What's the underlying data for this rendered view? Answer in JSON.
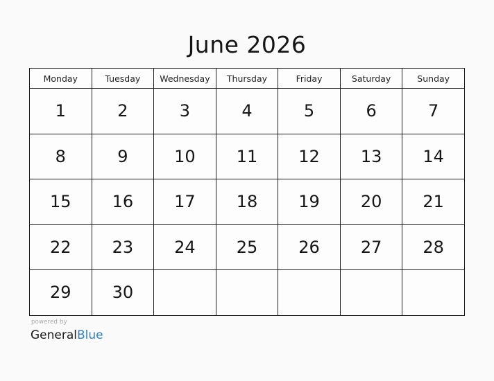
{
  "calendar": {
    "title": "June 2026",
    "month": "June",
    "year": "2026",
    "weekday_headers": [
      "Monday",
      "Tuesday",
      "Wednesday",
      "Thursday",
      "Friday",
      "Saturday",
      "Sunday"
    ],
    "weeks": [
      [
        "1",
        "2",
        "3",
        "4",
        "5",
        "6",
        "7"
      ],
      [
        "8",
        "9",
        "10",
        "11",
        "12",
        "13",
        "14"
      ],
      [
        "15",
        "16",
        "17",
        "18",
        "19",
        "20",
        "21"
      ],
      [
        "22",
        "23",
        "24",
        "25",
        "26",
        "27",
        "28"
      ],
      [
        "29",
        "30",
        "",
        "",
        "",
        "",
        ""
      ]
    ]
  },
  "branding": {
    "powered_by": "powered by",
    "name_first": "General",
    "name_second": "Blue",
    "accent_color": "#2f7fc5",
    "text_color": "#1a1a1a",
    "muted_color": "#a8a8a8"
  },
  "theme": {
    "background": "#fbfafa",
    "cell_background": "#fdfdfd",
    "border_color": "#1c1c1c"
  }
}
